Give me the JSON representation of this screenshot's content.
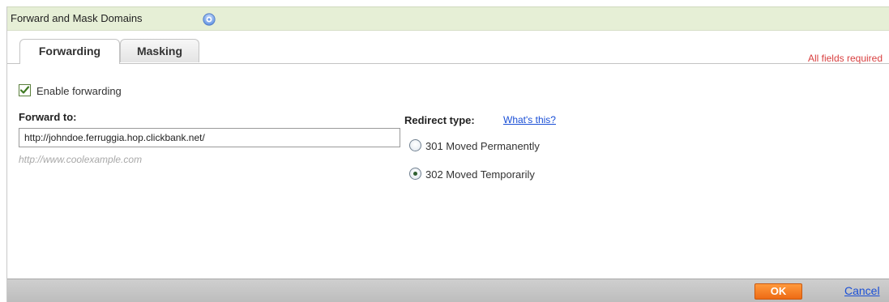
{
  "dialog": {
    "title": "Forward and Mask Domains",
    "help_icon": "help-icon",
    "required_note": "All fields required"
  },
  "tabs": [
    {
      "label": "Forwarding",
      "active": true
    },
    {
      "label": "Masking",
      "active": false
    }
  ],
  "forwarding": {
    "enable_label": "Enable forwarding",
    "enable_checked": true,
    "forward_to_label": "Forward to:",
    "forward_to_value": "http://johndoe.ferruggia.hop.clickbank.net/",
    "example_hint": "http://www.coolexample.com",
    "redirect_label": "Redirect type:",
    "whats_this": "What's this?",
    "options": [
      {
        "label": "301 Moved Permanently",
        "checked": false
      },
      {
        "label": "302 Moved Temporarily",
        "checked": true
      }
    ]
  },
  "footer": {
    "ok_label": "OK",
    "cancel_label": "Cancel"
  },
  "colors": {
    "titlebar_bg": "#e6efd6",
    "required_text": "#d94040",
    "link": "#1a4fd6",
    "ok_button": "#f07a22"
  }
}
